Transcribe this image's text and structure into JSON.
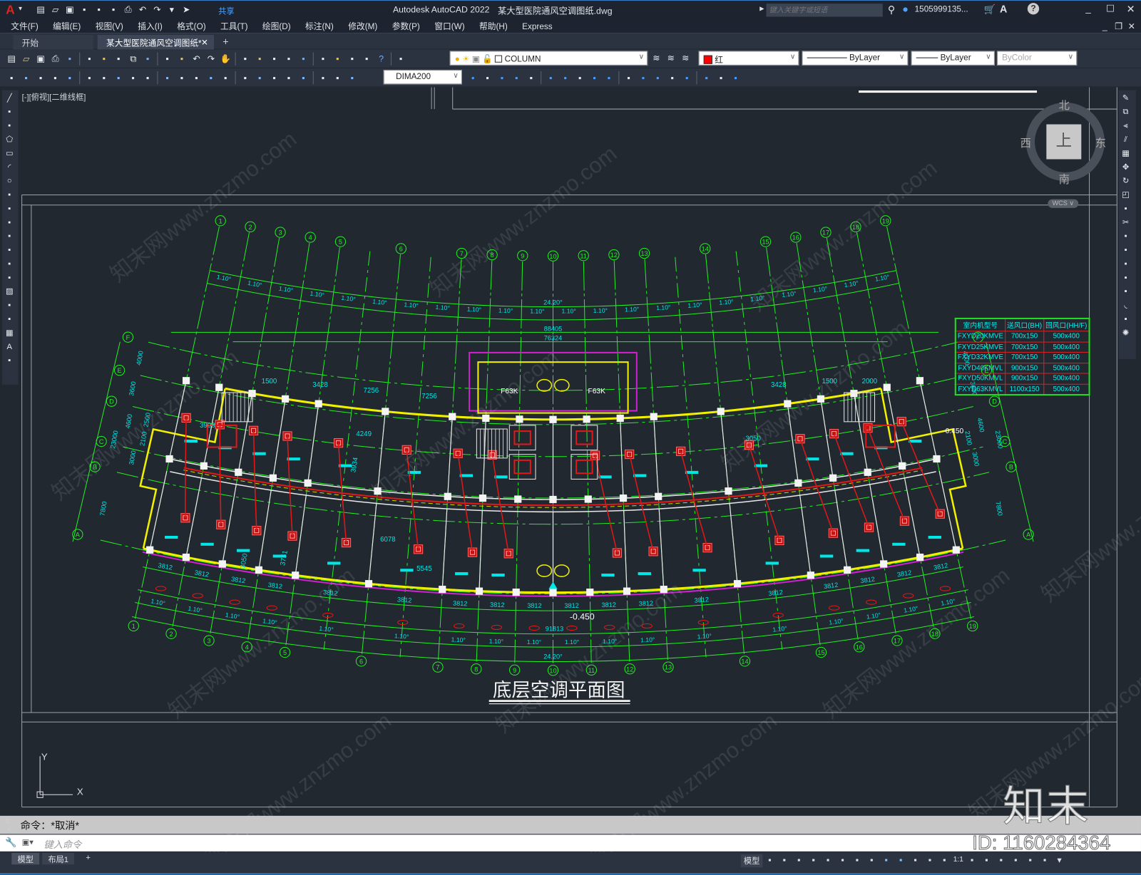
{
  "app": {
    "logo": "A",
    "title": "Autodesk AutoCAD 2022",
    "filename": "某大型医院通风空调图纸.dwg",
    "share": "共享",
    "search_placeholder": "键入关键字或短语",
    "user": "1505999135...",
    "accent": "#e2231a"
  },
  "quick_access_icons": [
    "new",
    "open",
    "save",
    "save-as",
    "open-web",
    "save-web",
    "plot",
    "undo",
    "redo",
    "customize",
    "share"
  ],
  "menu": [
    "文件(F)",
    "编辑(E)",
    "视图(V)",
    "插入(I)",
    "格式(O)",
    "工具(T)",
    "绘图(D)",
    "标注(N)",
    "修改(M)",
    "参数(P)",
    "窗口(W)",
    "帮助(H)",
    "Express"
  ],
  "tabs": [
    {
      "label": "开始"
    },
    {
      "label": "某大型医院通风空调图纸*",
      "active": true
    }
  ],
  "toolbar": {
    "row1_icons": [
      "new",
      "open",
      "save",
      "plot",
      "plot-preview",
      "publish",
      "3d-print",
      "cut",
      "copy",
      "paste",
      "match-properties",
      "block-editor",
      "undo",
      "redo",
      "pan",
      "zoom-realtime",
      "zoom-window",
      "zoom-previous",
      "properties",
      "design-center",
      "tool-palettes",
      "sheet-set",
      "markup",
      "calculator",
      "help",
      "layer-properties"
    ],
    "layer": "COLUMN",
    "layer_state_icons": [
      "bulb",
      "sun",
      "freeze",
      "lock"
    ],
    "color": "红",
    "color_hex": "#ff0000",
    "linetype": "ByLayer",
    "lineweight": "ByLayer",
    "plotstyle": "ByColor",
    "row2_icons": [
      "dim-update",
      "dim-check",
      "dim-style",
      "linear-dim",
      "aligned-dim",
      "arc-length",
      "ordinate",
      "radius",
      "jogged",
      "diameter",
      "angular",
      "quick-dim",
      "baseline",
      "continue",
      "dim-space",
      "dim-break",
      "tolerance",
      "center-mark",
      "inspect",
      "jogged-linear",
      "dim-edit",
      "dim-text-edit",
      "dim-override"
    ],
    "dimstyle": "DIMA200",
    "row2b_icons": [
      "union",
      "subtract",
      "intersect",
      "extrude-face",
      "move-face",
      "offset-face",
      "delete-face",
      "rotate-face",
      "taper-face",
      "copy-face",
      "color-face",
      "imprint",
      "color-edge",
      "copy-edge",
      "clean",
      "separate",
      "shell",
      "check"
    ]
  },
  "left_toolbar_icons": [
    "line",
    "construction-line",
    "polyline",
    "polygon",
    "rectangle",
    "arc",
    "circle",
    "revision-cloud",
    "spline",
    "ellipse",
    "ellipse-arc",
    "insert-block",
    "make-block",
    "point",
    "hatch",
    "gradient",
    "region",
    "table",
    "multiline-text",
    "add-selected"
  ],
  "right_toolbar_icons": [
    "erase",
    "copy",
    "mirror",
    "offset",
    "array",
    "move",
    "rotate",
    "scale",
    "stretch",
    "trim",
    "extend",
    "break-at-point",
    "break",
    "join",
    "chamfer",
    "fillet",
    "blend-curves",
    "explode"
  ],
  "viewport": {
    "label": "[-][俯视][二维线框]"
  },
  "viewcube": {
    "north": "北",
    "south": "南",
    "east": "东",
    "west": "西",
    "top": "上",
    "wcs": "WCS"
  },
  "drawing": {
    "title": "底层空调平面图",
    "axis_numbers": [
      "1",
      "2",
      "3",
      "4",
      "5",
      "6",
      "7",
      "8",
      "9",
      "10",
      "11",
      "12",
      "13",
      "14",
      "15",
      "16",
      "17",
      "18",
      "19"
    ],
    "axis_letters": [
      "A",
      "B",
      "C",
      "D",
      "E",
      "F"
    ],
    "bay_angle": "1.10°",
    "total_angle": "24.20°",
    "overall_dims": {
      "top1": "88405",
      "top2": "76324",
      "bottom": "91813"
    },
    "bay_dim": "3812",
    "elevation": "-0.450",
    "fan_label": "F63K",
    "room_dims": [
      "1500",
      "3428",
      "7256",
      "7256",
      "3428",
      "1500",
      "2000",
      "3908",
      "4249",
      "3934",
      "6078",
      "3050",
      "3751",
      "5545",
      "3050"
    ],
    "left_dims": [
      "4000",
      "3600",
      "2500",
      "4600",
      "2100",
      "3000",
      "23000",
      "7800"
    ],
    "right_dims": [
      "4000",
      "3600",
      "4600",
      "2100",
      "3000",
      "23000",
      "7800"
    ],
    "colors": {
      "grid": "#22ee22",
      "dim_text": "#00e5e5",
      "wall": "#e8e8e8",
      "outer_wall": "#f0f000",
      "duct": "#e01818",
      "core": "#d020d0"
    }
  },
  "table": {
    "headers": [
      "室内机型号",
      "送风口(BH)",
      "回风口(HH/F)"
    ],
    "rows": [
      [
        "FXYD20KMVE",
        "700x150",
        "500x400"
      ],
      [
        "FXYD25KMVE",
        "700x150",
        "500x400"
      ],
      [
        "FXYD32KMVE",
        "700x150",
        "500x400"
      ],
      [
        "FXYD40KMVL",
        "900x150",
        "500x400"
      ],
      [
        "FXYD50KMVL",
        "900x150",
        "500x400"
      ],
      [
        "FXYD63KMVL",
        "1100x150",
        "500x400"
      ]
    ]
  },
  "ucs": {
    "x": "X",
    "y": "Y"
  },
  "command": {
    "history": "命令：*取消*",
    "placeholder": "键入命令"
  },
  "layout_tabs": [
    "模型",
    "布局1"
  ],
  "status": {
    "model": "模型",
    "scale": "1:1",
    "icons": [
      "grid",
      "snap",
      "ortho",
      "polar",
      "isodraw",
      "object-snap-tracking",
      "object-snap",
      "lineweight",
      "transparency",
      "selection-cycling",
      "annotation-visibility",
      "auto-scale",
      "annotation-scale",
      "workspace",
      "annotation-monitor",
      "units",
      "quick-properties",
      "isolate",
      "fullscreen",
      "customize"
    ]
  },
  "watermark": {
    "brand": "知末",
    "id": "ID: 1160284364",
    "diagonal": "知末网www.znzmo.com"
  }
}
